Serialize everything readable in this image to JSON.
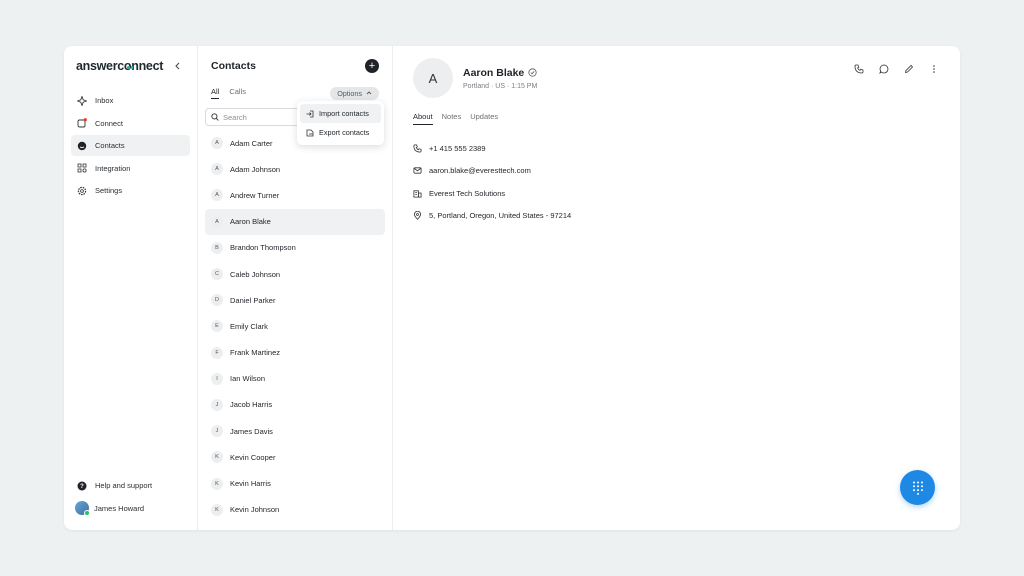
{
  "brand": {
    "name": "answerconnect"
  },
  "sidebar": {
    "items": [
      {
        "label": "Inbox",
        "icon": "inbox-icon"
      },
      {
        "label": "Connect",
        "icon": "connect-icon"
      },
      {
        "label": "Contacts",
        "icon": "contacts-icon",
        "active": true
      },
      {
        "label": "Integration",
        "icon": "integration-icon"
      },
      {
        "label": "Settings",
        "icon": "gear-icon"
      }
    ],
    "help_label": "Help and support",
    "user_name": "James Howard"
  },
  "contacts": {
    "title": "Contacts",
    "tabs": [
      {
        "label": "All"
      },
      {
        "label": "Calls"
      }
    ],
    "options_label": "Options",
    "search_placeholder": "Search",
    "dropdown": [
      {
        "label": "Import contacts"
      },
      {
        "label": "Export contacts"
      }
    ],
    "list": [
      {
        "initial": "A",
        "name": "Adam Carter"
      },
      {
        "initial": "A",
        "name": "Adam Johnson"
      },
      {
        "initial": "A",
        "name": "Andrew Turner"
      },
      {
        "initial": "A",
        "name": "Aaron Blake"
      },
      {
        "initial": "B",
        "name": "Brandon Thompson"
      },
      {
        "initial": "C",
        "name": "Caleb Johnson"
      },
      {
        "initial": "D",
        "name": "Daniel Parker"
      },
      {
        "initial": "E",
        "name": "Emily Clark"
      },
      {
        "initial": "F",
        "name": "Frank Martinez"
      },
      {
        "initial": "I",
        "name": "Ian Wilson"
      },
      {
        "initial": "J",
        "name": "Jacob Harris"
      },
      {
        "initial": "J",
        "name": "James Davis"
      },
      {
        "initial": "K",
        "name": "Kevin Cooper"
      },
      {
        "initial": "K",
        "name": "Kevin Harris"
      },
      {
        "initial": "K",
        "name": "Kevin Johnson"
      }
    ]
  },
  "detail": {
    "initial": "A",
    "name": "Aaron Blake",
    "subtitle": "Portland · US · 1:15 PM",
    "tabs": [
      {
        "label": "About"
      },
      {
        "label": "Notes"
      },
      {
        "label": "Updates"
      }
    ],
    "phone": "+1 415 555 2389",
    "email": "aaron.blake@everesttech.com",
    "company": "Everest Tech Solutions",
    "address": "5, Portland, Oregon, United States - 97214"
  },
  "colors": {
    "accent": "#1e88e5",
    "brand_dots": "#2db5a3"
  }
}
